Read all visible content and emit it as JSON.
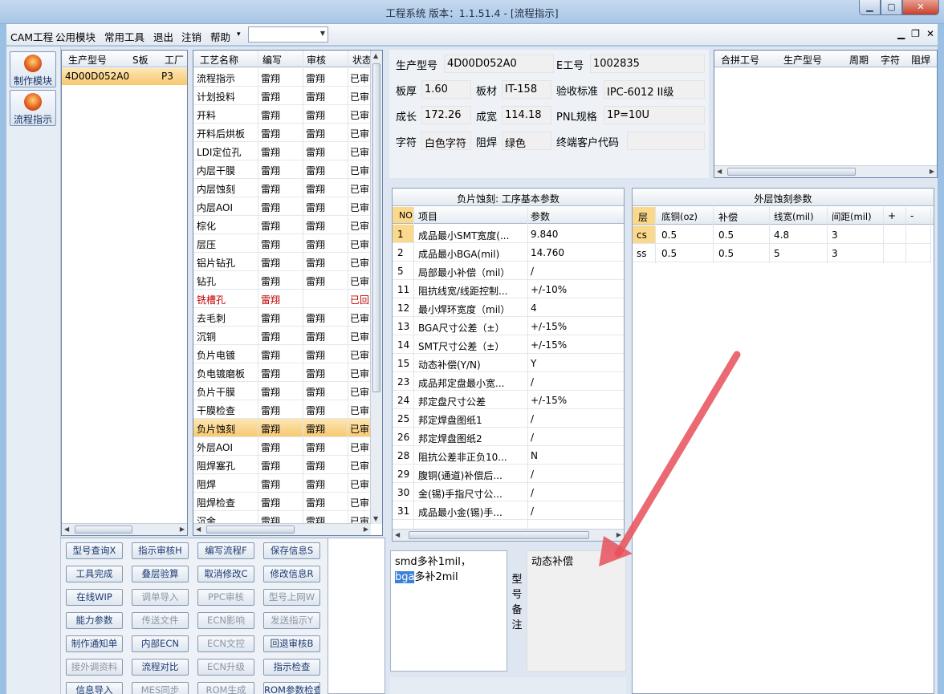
{
  "window": {
    "title": "工程系统   版本：1.1.51.4 - [流程指示]"
  },
  "menu": [
    "CAM工程",
    "公用模块",
    "常用工具",
    "退出",
    "注销",
    "帮助"
  ],
  "nav": [
    {
      "label": "制作模块"
    },
    {
      "label": "流程指示"
    }
  ],
  "model_grid": {
    "headers": [
      "生产型号",
      "S板",
      "工厂"
    ],
    "rows": [
      [
        "4D00D052A0",
        "",
        "P3"
      ]
    ]
  },
  "process_grid": {
    "headers": [
      "工艺名称",
      "编写",
      "审核",
      "状态"
    ],
    "rows": [
      [
        "流程指示",
        "雷翔",
        "雷翔",
        "已审"
      ],
      [
        "计划投料",
        "雷翔",
        "雷翔",
        "已审"
      ],
      [
        "开料",
        "雷翔",
        "雷翔",
        "已审"
      ],
      [
        "开料后烘板",
        "雷翔",
        "雷翔",
        "已审"
      ],
      [
        "LDI定位孔",
        "雷翔",
        "雷翔",
        "已审"
      ],
      [
        "内层干膜",
        "雷翔",
        "雷翔",
        "已审"
      ],
      [
        "内层蚀刻",
        "雷翔",
        "雷翔",
        "已审"
      ],
      [
        "内层AOI",
        "雷翔",
        "雷翔",
        "已审"
      ],
      [
        "棕化",
        "雷翔",
        "雷翔",
        "已审"
      ],
      [
        "层压",
        "雷翔",
        "雷翔",
        "已审"
      ],
      [
        "铝片钻孔",
        "雷翔",
        "雷翔",
        "已审"
      ],
      [
        "钻孔",
        "雷翔",
        "雷翔",
        "已审"
      ],
      [
        "铣槽孔",
        "雷翔",
        "",
        "已回"
      ],
      [
        "去毛刺",
        "雷翔",
        "雷翔",
        "已审"
      ],
      [
        "沉铜",
        "雷翔",
        "雷翔",
        "已审"
      ],
      [
        "负片电镀",
        "雷翔",
        "雷翔",
        "已审"
      ],
      [
        "负电镀磨板",
        "雷翔",
        "雷翔",
        "已审"
      ],
      [
        "负片干膜",
        "雷翔",
        "雷翔",
        "已审"
      ],
      [
        "干膜检查",
        "雷翔",
        "雷翔",
        "已审"
      ],
      [
        "负片蚀刻",
        "雷翔",
        "雷翔",
        "已审"
      ],
      [
        "外层AOI",
        "雷翔",
        "雷翔",
        "已审"
      ],
      [
        "阻焊塞孔",
        "雷翔",
        "雷翔",
        "已审"
      ],
      [
        "阻焊",
        "雷翔",
        "雷翔",
        "已审"
      ],
      [
        "阻焊检查",
        "雷翔",
        "雷翔",
        "已审"
      ],
      [
        "沉金",
        "雷翔",
        "雷翔",
        "已审"
      ]
    ],
    "selected_index": 19,
    "rejected_index": 12
  },
  "buttons": [
    [
      "型号查询X",
      "指示审核H",
      "编写流程F",
      "保存信息S"
    ],
    [
      "工具完成",
      "叠层验算",
      "取消修改C",
      "修改信息R"
    ],
    [
      "在线WIP",
      "调单导入",
      "PPC审核",
      "型号上网W"
    ],
    [
      "能力参数",
      "传送文件",
      "ECN影响",
      "发送指示Y"
    ],
    [
      "制作通知单",
      "内部ECN",
      "ECN文控",
      "回退审核B"
    ],
    [
      "接外调资料",
      "流程对比",
      "ECN升级",
      "指示检查"
    ],
    [
      "信息导入",
      "MES同步",
      "ROM生成",
      "ROM参数检查"
    ]
  ],
  "buttons_disabled": [
    "调单导入",
    "PPC审核",
    "型号上网W",
    "传送文件",
    "ECN影响",
    "发送指示Y",
    "ECN文控",
    "接外调资料",
    "ECN升级",
    "MES同步",
    "ROM生成"
  ],
  "info": {
    "fields": {
      "prod_model_label": "生产型号",
      "prod_model": "4D00D052A0",
      "e_no_label": "E工号",
      "e_no": "1002835",
      "thickness_label": "板厚",
      "thickness": "1.60",
      "material_label": "板材",
      "material": "IT-158",
      "standard_label": "验收标准",
      "standard": "IPC-6012 II级",
      "length_label": "成长",
      "length": "172.26",
      "width_label": "成宽",
      "width": "114.18",
      "pnl_label": "PNL规格",
      "pnl": "1P=10U",
      "legend_label": "字符",
      "legend": "白色字符",
      "mask_label": "阻焊",
      "mask": "绿色",
      "end_customer_label": "终端客户代码",
      "end_customer": ""
    }
  },
  "merge_grid": {
    "headers": [
      "合拼工号",
      "生产型号",
      "周期",
      "字符",
      "阻焊"
    ]
  },
  "param_panel": {
    "title": "负片蚀刻: 工序基本参数",
    "headers": [
      "NO",
      "项目",
      "参数"
    ],
    "rows": [
      [
        "1",
        "成品最小SMT宽度(...",
        "9.840"
      ],
      [
        "2",
        "成品最小BGA(mil)",
        "14.760"
      ],
      [
        "5",
        "局部最小补偿（mil）",
        "/"
      ],
      [
        "11",
        "阻抗线宽/线距控制...",
        "+/-10%"
      ],
      [
        "12",
        "最小焊环宽度（mil）",
        "4"
      ],
      [
        "13",
        "BGA尺寸公差（±）",
        "+/-15%"
      ],
      [
        "14",
        "SMT尺寸公差（±）",
        "+/-15%"
      ],
      [
        "15",
        "动态补偿(Y/N)",
        "Y"
      ],
      [
        "23",
        "成品邦定盘最小宽...",
        "/"
      ],
      [
        "24",
        "邦定盘尺寸公差",
        "+/-15%"
      ],
      [
        "25",
        "邦定焊盘图纸1",
        "/"
      ],
      [
        "26",
        "邦定焊盘图纸2",
        "/"
      ],
      [
        "28",
        "阻抗公差非正负10...",
        "N"
      ],
      [
        "29",
        "腹铜(通道)补偿后...",
        "/"
      ],
      [
        "30",
        "金(锡)手指尺寸公...",
        "/"
      ],
      [
        "31",
        "成品最小金(锡)手...",
        "/"
      ]
    ]
  },
  "outer_panel": {
    "title": "外层蚀刻参数",
    "headers": [
      "层",
      "底铜(oz)",
      "补偿",
      "线宽(mil)",
      "间距(mil)",
      "+",
      "-"
    ],
    "rows": [
      [
        "cs",
        "0.5",
        "0.5",
        "4.8",
        "3"
      ],
      [
        "ss",
        "0.5",
        "0.5",
        "5",
        "3"
      ]
    ]
  },
  "memo": {
    "line1": "smd多补1mil，",
    "line2_hl": "bga",
    "line2_rest": "多补2mil",
    "note_label": "型号备注",
    "note_value": "动态补偿"
  },
  "colors": {
    "selected_row": "#f7c86e",
    "rejected_text": "#c00000",
    "arrow": "#e8505a"
  }
}
